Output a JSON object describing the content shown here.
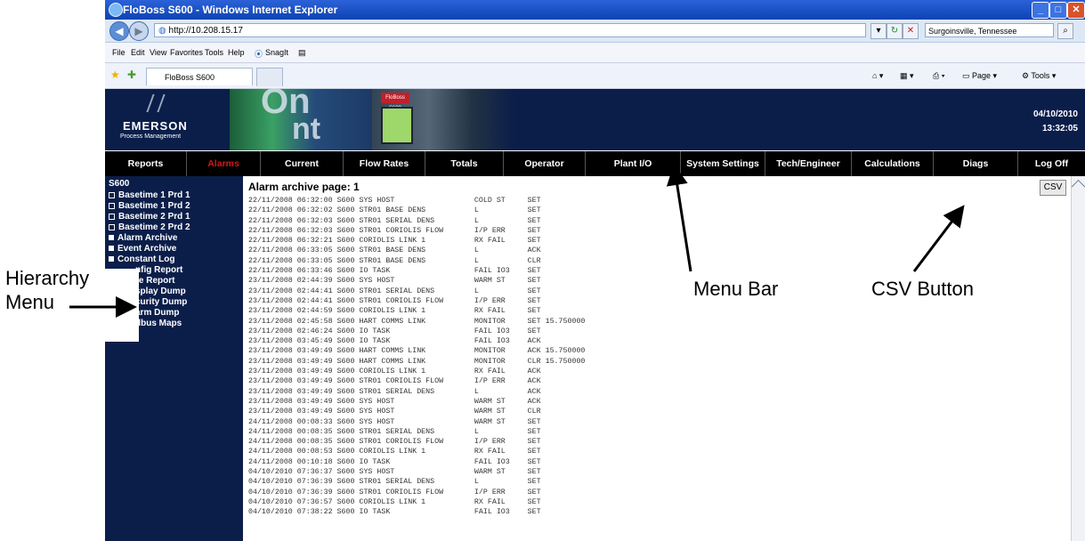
{
  "browser": {
    "title": "FloBoss S600 - Windows Internet Explorer",
    "url": "http://10.208.15.17",
    "search": "Surgoinsville, Tennessee",
    "menu": [
      "File",
      "Edit",
      "View",
      "Favorites",
      "Tools",
      "Help"
    ],
    "snagit": "SnagIt",
    "tab_title": "FloBoss S600",
    "right_tools": [
      "Page",
      "Tools"
    ]
  },
  "banner": {
    "brand": "EMERSON",
    "sub": "Process Management",
    "device_label": "FloBoss S600",
    "date": "04/10/2010",
    "time": "13:32:05"
  },
  "nav": [
    "Reports",
    "Alarms",
    "Current",
    "Flow Rates",
    "Totals",
    "Operator",
    "Plant I/O",
    "System Settings",
    "Tech/Engineer",
    "Calculations",
    "Diags",
    "Log Off"
  ],
  "sidebar": {
    "header": "S600",
    "items": [
      {
        "label": "Basetime 1 Prd 1",
        "style": "box"
      },
      {
        "label": "Basetime 1 Prd 2",
        "style": "box"
      },
      {
        "label": "Basetime 2 Prd 1",
        "style": "box"
      },
      {
        "label": "Basetime 2 Prd 2",
        "style": "box"
      },
      {
        "label": "Alarm Archive",
        "style": "solid"
      },
      {
        "label": "Event Archive",
        "style": "solid"
      },
      {
        "label": "Constant Log",
        "style": "solid"
      },
      {
        "label": "nfig Report",
        "style": "none"
      },
      {
        "label": "re Report",
        "style": "none"
      },
      {
        "label": "splay Dump",
        "style": "none"
      },
      {
        "label": "curity Dump",
        "style": "none"
      },
      {
        "label": "arm Dump",
        "style": "none"
      },
      {
        "label": "dbus Maps",
        "style": "none"
      }
    ]
  },
  "content": {
    "title": "Alarm archive page: 1",
    "csv": "CSV",
    "rows": [
      "22/11/2008 06:32:00 S600 SYS HOST                  COLD ST     SET",
      "22/11/2008 06:32:02 S600 STR01 BASE DENS           L           SET",
      "22/11/2008 06:32:03 S600 STR01 SERIAL DENS         L           SET",
      "22/11/2008 06:32:03 S600 STR01 CORIOLIS FLOW       I/P ERR     SET",
      "22/11/2008 06:32:21 S600 CORIOLIS LINK 1           RX FAIL     SET",
      "22/11/2008 06:33:05 S600 STR01 BASE DENS           L           ACK",
      "22/11/2008 06:33:05 S600 STR01 BASE DENS           L           CLR",
      "22/11/2008 06:33:46 S600 IO TASK                   FAIL IO3    SET",
      "23/11/2008 02:44:39 S600 SYS HOST                  WARM ST     SET",
      "23/11/2008 02:44:41 S600 STR01 SERIAL DENS         L           SET",
      "23/11/2008 02:44:41 S600 STR01 CORIOLIS FLOW       I/P ERR     SET",
      "23/11/2008 02:44:59 S600 CORIOLIS LINK 1           RX FAIL     SET",
      "23/11/2008 02:45:58 S600 HART COMMS LINK           MONITOR     SET 15.750000",
      "23/11/2008 02:46:24 S600 IO TASK                   FAIL IO3    SET",
      "23/11/2008 03:45:49 S600 IO TASK                   FAIL IO3    ACK",
      "23/11/2008 03:49:49 S600 HART COMMS LINK           MONITOR     ACK 15.750000",
      "23/11/2008 03:49:49 S600 HART COMMS LINK           MONITOR     CLR 15.750000",
      "23/11/2008 03:49:49 S600 CORIOLIS LINK 1           RX FAIL     ACK",
      "23/11/2008 03:49:49 S600 STR01 CORIOLIS FLOW       I/P ERR     ACK",
      "23/11/2008 03:49:49 S600 STR01 SERIAL DENS         L           ACK",
      "23/11/2008 03:49:49 S600 SYS HOST                  WARM ST     ACK",
      "23/11/2008 03:49:49 S600 SYS HOST                  WARM ST     CLR",
      "24/11/2008 00:08:33 S600 SYS HOST                  WARM ST     SET",
      "24/11/2008 00:08:35 S600 STR01 SERIAL DENS         L           SET",
      "24/11/2008 00:08:35 S600 STR01 CORIOLIS FLOW       I/P ERR     SET",
      "24/11/2008 00:08:53 S600 CORIOLIS LINK 1           RX FAIL     SET",
      "24/11/2008 00:10:18 S600 IO TASK                   FAIL IO3    SET",
      "04/10/2010 07:36:37 S600 SYS HOST                  WARM ST     SET",
      "04/10/2010 07:36:39 S600 STR01 SERIAL DENS         L           SET",
      "04/10/2010 07:36:39 S600 STR01 CORIOLIS FLOW       I/P ERR     SET",
      "04/10/2010 07:36:57 S600 CORIOLIS LINK 1           RX FAIL     SET",
      "04/10/2010 07:38:22 S600 IO TASK                   FAIL IO3    SET"
    ]
  },
  "annotations": {
    "hierarchy_1": "Hierarchy",
    "hierarchy_2": "Menu",
    "menubar": "Menu Bar",
    "csv": "CSV Button"
  }
}
